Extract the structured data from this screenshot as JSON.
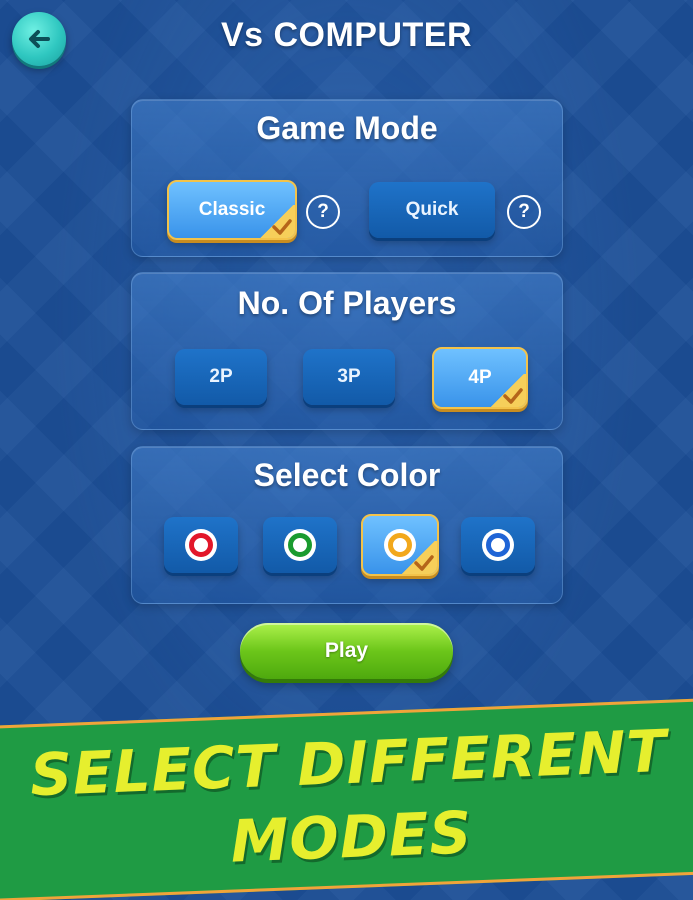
{
  "header": {
    "title": "Vs COMPUTER",
    "back_icon": "arrow-left-icon"
  },
  "game_mode": {
    "title": "Game Mode",
    "options": [
      {
        "label": "Classic",
        "selected": true,
        "help": "?"
      },
      {
        "label": "Quick",
        "selected": false,
        "help": "?"
      }
    ]
  },
  "players": {
    "title": "No. Of Players",
    "options": [
      {
        "label": "2P",
        "selected": false
      },
      {
        "label": "3P",
        "selected": false
      },
      {
        "label": "4P",
        "selected": true
      }
    ]
  },
  "color_select": {
    "title": "Select Color",
    "options": [
      {
        "name": "red",
        "color": "#e2172a",
        "selected": false
      },
      {
        "name": "green",
        "color": "#1a9b2f",
        "selected": false
      },
      {
        "name": "yellow",
        "color": "#f2a81c",
        "selected": true
      },
      {
        "name": "blue",
        "color": "#1f64d6",
        "selected": false
      }
    ]
  },
  "play": {
    "label": "Play"
  },
  "banner": {
    "line1": "SELECT DIFFERENT",
    "line2": "MODES"
  },
  "colors": {
    "background": "#1d4f97",
    "accent_gold": "#f3c34a",
    "play_green": "#6cc61a",
    "banner_green": "#1f9b44",
    "banner_text": "#e6ef2e"
  }
}
